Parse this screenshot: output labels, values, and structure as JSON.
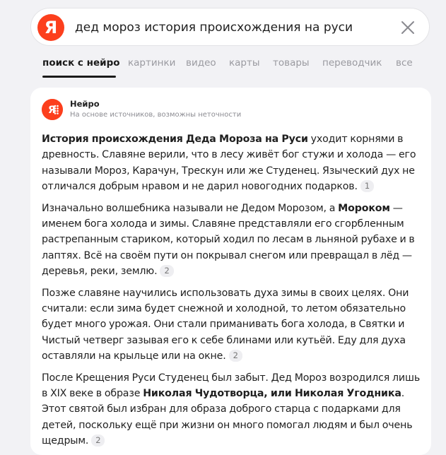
{
  "search": {
    "logo_letter": "Я",
    "query": "дед мороз история происхождения на руси"
  },
  "tabs": [
    {
      "label": "поиск с нейро",
      "active": true
    },
    {
      "label": "картинки"
    },
    {
      "label": "видео"
    },
    {
      "label": "карты"
    },
    {
      "label": "товары"
    },
    {
      "label": "переводчик"
    },
    {
      "label": "все"
    }
  ],
  "neiro": {
    "name": "Нейро",
    "subtitle": "На основе источников, возможны неточности",
    "paragraphs": [
      {
        "segments": [
          {
            "text": "История происхождения Деда Мороза на Руси",
            "bold": true
          },
          {
            "text": " уходит корнями в древность. Славяне верили, что в лесу живёт бог стужи и холода — его называли Мороз, Карачун, Трескун или же Студенец. Языческий дух не отличался добрым нравом и не дарил новогодних подарков."
          }
        ],
        "citation": "1"
      },
      {
        "segments": [
          {
            "text": "Изначально волшебника называли не Дедом Морозом, а "
          },
          {
            "text": "Мороком",
            "bold": true
          },
          {
            "text": " — именем бога холода и зимы. Славяне представляли его сгорбленным растрепанным стариком, который ходил по лесам в льняной рубахе и в лаптях. Всё на своём пути он покрывал снегом или превращал в лёд — деревья, реки, землю."
          }
        ],
        "citation": "2"
      },
      {
        "segments": [
          {
            "text": "Позже славяне научились использовать духа зимы в своих целях. Они считали: если зима будет снежной и холодной, то летом обязательно будет много урожая. Они стали приманивать бога холода, в Святки и Чистый четверг зазывая его к себе блинами или кутьёй. Еду для духа оставляли на крыльце или на окне."
          }
        ],
        "citation": "2"
      },
      {
        "segments": [
          {
            "text": "После Крещения Руси Студенец был забыт. Дед Мороз возродился лишь в XIX веке в образе "
          },
          {
            "text": "Николая Чудотворца, или Николая Угодника",
            "bold": true
          },
          {
            "text": ". Этот святой был избран для образа доброго старца с подарками для детей, поскольку ещё при жизни он много помогал людям и был очень щедрым."
          }
        ],
        "citation": "2"
      }
    ]
  },
  "colors": {
    "brand": "#fc3f1d",
    "page_bg": "#f2f2f5",
    "active_tab": "#1a1a1a",
    "inactive_tab": "#9a9aa0"
  }
}
